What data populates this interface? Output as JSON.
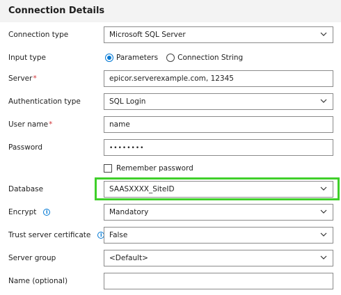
{
  "panel": {
    "title": "Connection Details"
  },
  "form": {
    "connection_type": {
      "label": "Connection type",
      "value": "Microsoft SQL Server"
    },
    "input_type": {
      "label": "Input type",
      "options": [
        "Parameters",
        "Connection String"
      ],
      "selected": "Parameters"
    },
    "server": {
      "label": "Server",
      "required_mark": "*",
      "value": "epicor.serverexample.com, 12345"
    },
    "authentication_type": {
      "label": "Authentication type",
      "value": "SQL Login"
    },
    "user_name": {
      "label": "User name",
      "required_mark": "*",
      "value": "name"
    },
    "password": {
      "label": "Password",
      "value": "••••••••"
    },
    "remember_password": {
      "label": "Remember password",
      "checked": false
    },
    "database": {
      "label": "Database",
      "value": "SAASXXXX_SiteID"
    },
    "encrypt": {
      "label": "Encrypt",
      "value": "Mandatory"
    },
    "trust_server_certificate": {
      "label": "Trust server certificate",
      "value": "False"
    },
    "server_group": {
      "label": "Server group",
      "value": "<Default>"
    },
    "name_optional": {
      "label": "Name (optional)",
      "value": ""
    }
  },
  "icons": {
    "info": "i"
  },
  "colors": {
    "highlight": "#3fcf2a",
    "accent": "#0078d4",
    "required": "#d13438",
    "header_bg": "#f3f3f3"
  }
}
